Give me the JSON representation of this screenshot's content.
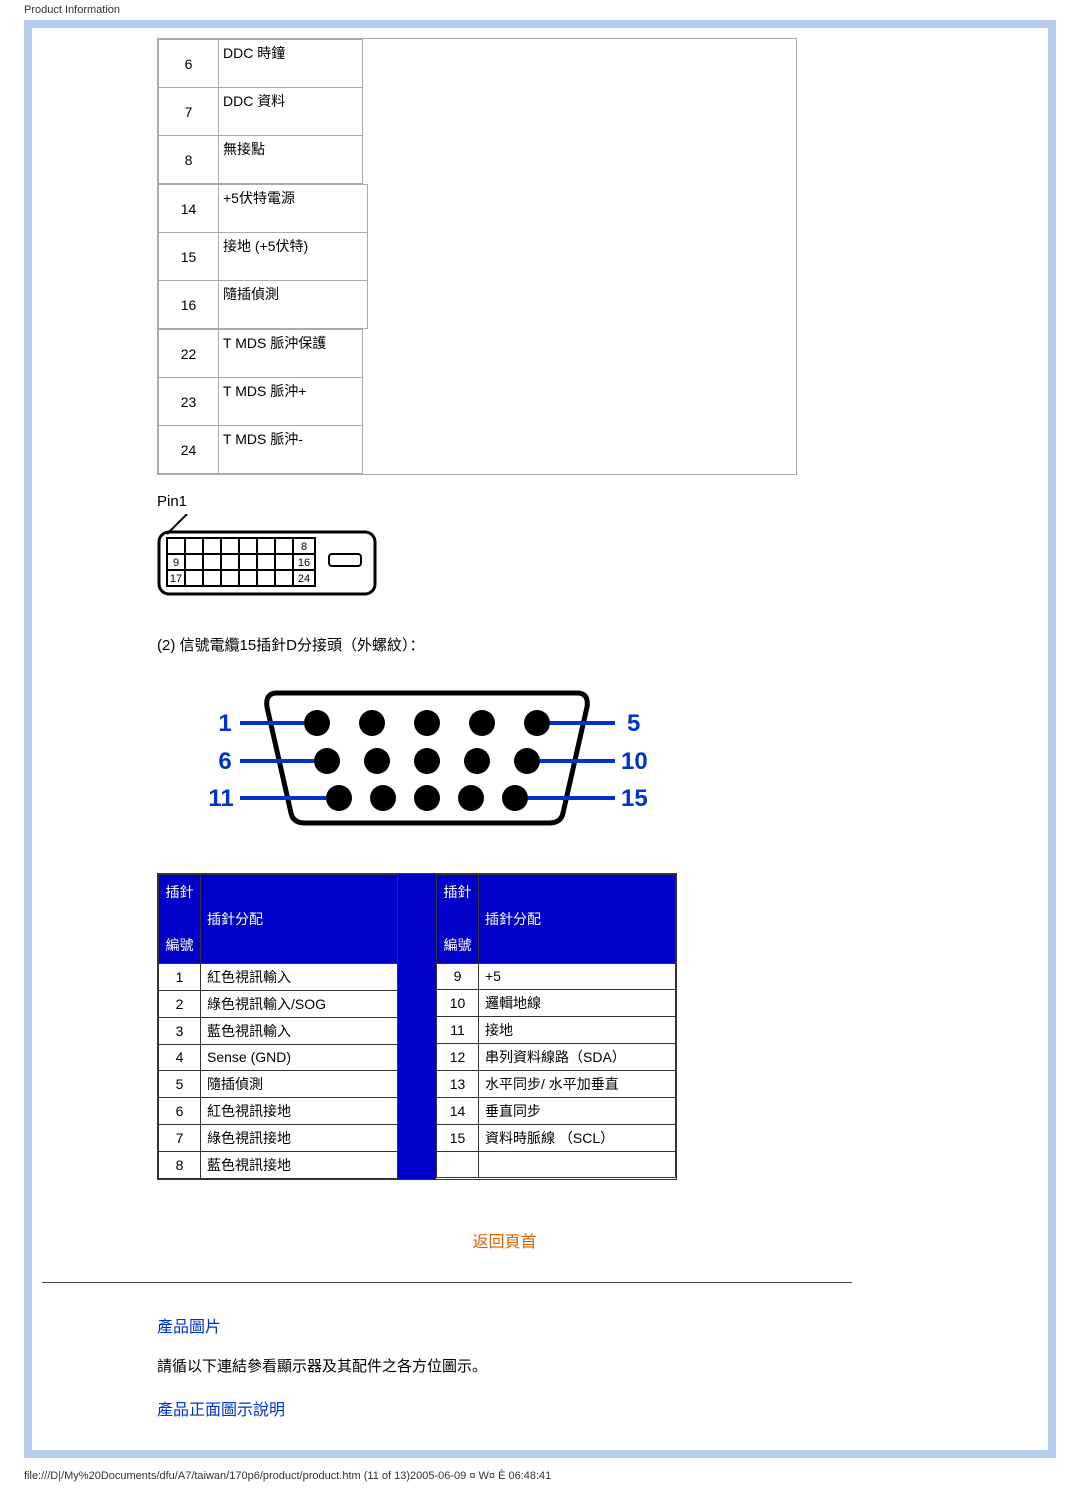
{
  "header_text": "Product Information",
  "dvi_rows": {
    "col1": [
      {
        "num": "6",
        "label": "DDC 時鐘"
      },
      {
        "num": "7",
        "label": "DDC 資料"
      },
      {
        "num": "8",
        "label": "無接點"
      }
    ],
    "col2": [
      {
        "num": "14",
        "label": "+5伏特電源"
      },
      {
        "num": "15",
        "label": "接地 (+5伏特)"
      },
      {
        "num": "16",
        "label": "隨插偵測"
      }
    ],
    "col3": [
      {
        "num": "22",
        "label": "T MDS 脈沖保護"
      },
      {
        "num": "23",
        "label": "T MDS 脈沖+"
      },
      {
        "num": "24",
        "label": "T MDS 脈沖-"
      }
    ]
  },
  "pin1_label": "Pin1",
  "dvi_diagram_numbers": {
    "a": "8",
    "b": "9",
    "c": "16",
    "d": "17",
    "e": "24"
  },
  "section_2_title": "(2) 信號電纜15插針D分接頭（外螺紋）：",
  "vga_diagram_numbers": {
    "n1": "1",
    "n5": "5",
    "n6": "6",
    "n10": "10",
    "n11": "11",
    "n15": "15"
  },
  "vga_headers": {
    "pin_no": "插針",
    "pin_no2": "編號",
    "assign": "插針分配"
  },
  "vga_left": [
    {
      "num": "1",
      "label": "紅色視訊輸入"
    },
    {
      "num": "2",
      "label": "綠色視訊輸入/SOG"
    },
    {
      "num": "3",
      "label": "藍色視訊輸入"
    },
    {
      "num": "4",
      "label": "Sense (GND)"
    },
    {
      "num": "5",
      "label": "隨插偵測"
    },
    {
      "num": "6",
      "label": "紅色視訊接地"
    },
    {
      "num": "7",
      "label": "綠色視訊接地"
    },
    {
      "num": "8",
      "label": "藍色視訊接地"
    }
  ],
  "vga_right": [
    {
      "num": "9",
      "label": "+5"
    },
    {
      "num": "10",
      "label": "邏輯地線"
    },
    {
      "num": "11",
      "label": "接地"
    },
    {
      "num": "12",
      "label": "串列資料線路（SDA）"
    },
    {
      "num": "13",
      "label": "水平同步/ 水平加垂直"
    },
    {
      "num": "14",
      "label": "垂直同步"
    },
    {
      "num": "15",
      "label": "資料時脈線 （SCL）"
    },
    {
      "num": "",
      "label": ""
    }
  ],
  "back_to_top": "返回頁首",
  "product_image_title": "產品圖片",
  "product_image_text": "請循以下連結參看顯示器及其配件之各方位圖示。",
  "product_front_link": "產品正面圖示說明",
  "footer_text": "file:///D|/My%20Documents/dfu/A7/taiwan/170p6/product/product.htm (11 of 13)2005-06-09 ¤ W¤ È 06:48:41"
}
